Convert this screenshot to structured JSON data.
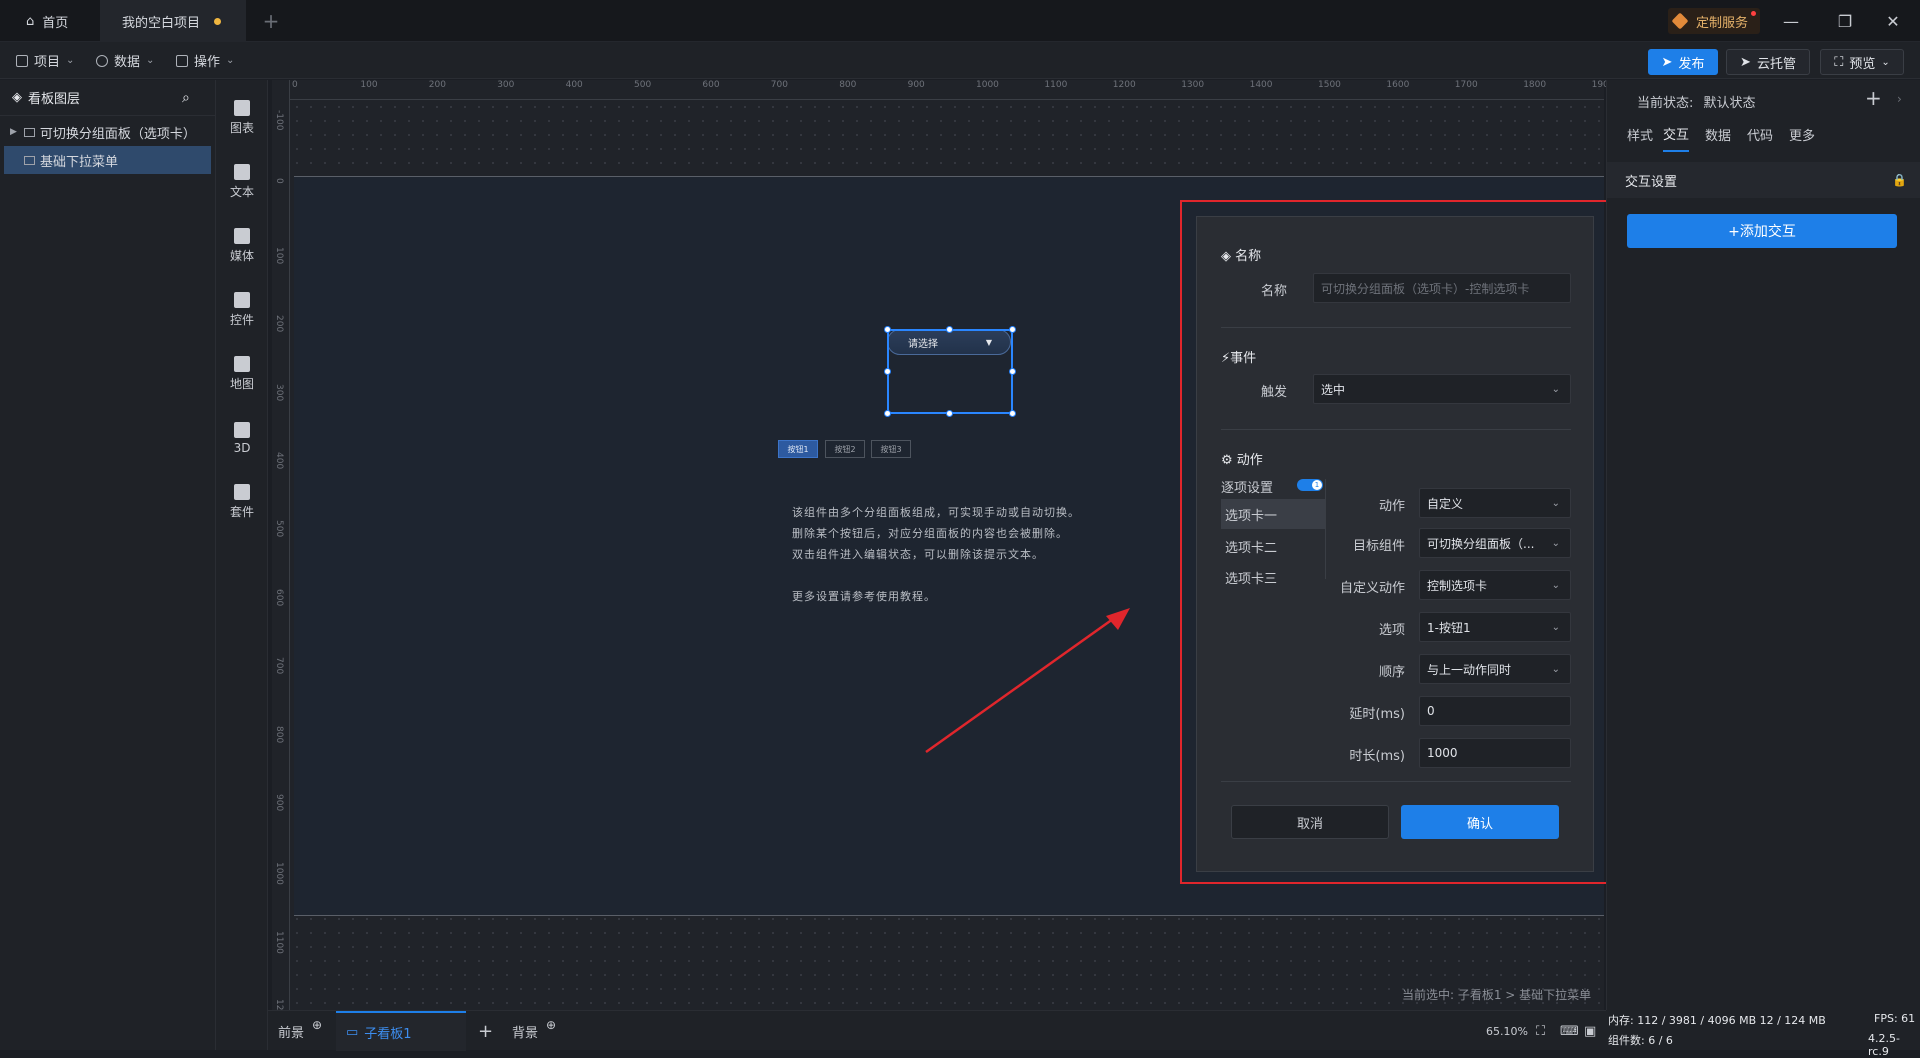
{
  "titlebar": {
    "tabs": [
      {
        "label": "首页"
      },
      {
        "label": "我的空白项目"
      }
    ],
    "custom_service": "定制服务"
  },
  "menubar": {
    "items": [
      "项目",
      "数据",
      "操作"
    ],
    "publish": "发布",
    "cloud": "云托管",
    "preview": "预览"
  },
  "layers": {
    "title": "看板图层",
    "items": [
      "可切换分组面板（选项卡）",
      "基础下拉菜单"
    ]
  },
  "components": [
    "图表",
    "文本",
    "媒体",
    "控件",
    "地图",
    "3D",
    "套件"
  ],
  "ruler": {
    "h_ticks": [
      "0",
      "100",
      "200",
      "300",
      "400",
      "500",
      "600",
      "700",
      "800",
      "900",
      "1000",
      "1100",
      "1200",
      "1300",
      "1400",
      "1500",
      "1600",
      "1700",
      "1800",
      "1900"
    ],
    "v_ticks": [
      "-100",
      "0",
      "100",
      "200",
      "300",
      "400",
      "500",
      "600",
      "700",
      "800",
      "900",
      "1000",
      "1100",
      "1200"
    ]
  },
  "canvas": {
    "dropdown_placeholder": "请选择",
    "mini_tabs": [
      "按钮1",
      "按钮2",
      "按钮3"
    ],
    "hint_lines": [
      "该组件由多个分组面板组成，可实现手动或自动切换。",
      "删除某个按钮后，对应分组面板的内容也会被删除。",
      "双击组件进入编辑状态，可以删除该提示文本。",
      "",
      "更多设置请参考使用教程。"
    ],
    "selection_path": "当前选中: 子看板1 > 基础下拉菜单"
  },
  "dialog": {
    "name_section": "名称",
    "name_label": "名称",
    "name_placeholder": "可切换分组面板（选项卡）-控制选项卡",
    "event_section": "事件",
    "trigger_label": "触发",
    "trigger_value": "选中",
    "action_section": "动作",
    "per_item_label": "逐项设置",
    "per_item_badge": "1",
    "tab_items": [
      "选项卡一",
      "选项卡二",
      "选项卡三"
    ],
    "fields": [
      {
        "label": "动作",
        "value": "自定义"
      },
      {
        "label": "目标组件",
        "value": "可切换分组面板（..."
      },
      {
        "label": "自定义动作",
        "value": "控制选项卡"
      },
      {
        "label": "选项",
        "value": "1-按钮1"
      },
      {
        "label": "顺序",
        "value": "与上一动作同时"
      },
      {
        "label": "延时(ms)",
        "value": "0"
      },
      {
        "label": "时长(ms)",
        "value": "1000"
      }
    ],
    "cancel": "取消",
    "confirm": "确认"
  },
  "rpanel": {
    "state_label": "当前状态:",
    "state_value": "默认状态",
    "tabs": [
      "样式",
      "交互",
      "数据",
      "代码",
      "更多"
    ],
    "section": "交互设置",
    "add_interaction": "+添加交互"
  },
  "bottombar": {
    "tabs": [
      "前景",
      "子看板1",
      "背景"
    ],
    "zoom": "65.10%"
  },
  "status": {
    "memory": "内存:  112 / 3981 / 4096 MB  12 / 124 MB",
    "fps": "FPS:  61",
    "count": "组件数: 6 / 6",
    "version": "4.2.5-rc.9"
  },
  "colors": {
    "accent": "#1e7fe8",
    "highlight_frame": "#e0262c",
    "arrow": "#e0262c"
  }
}
